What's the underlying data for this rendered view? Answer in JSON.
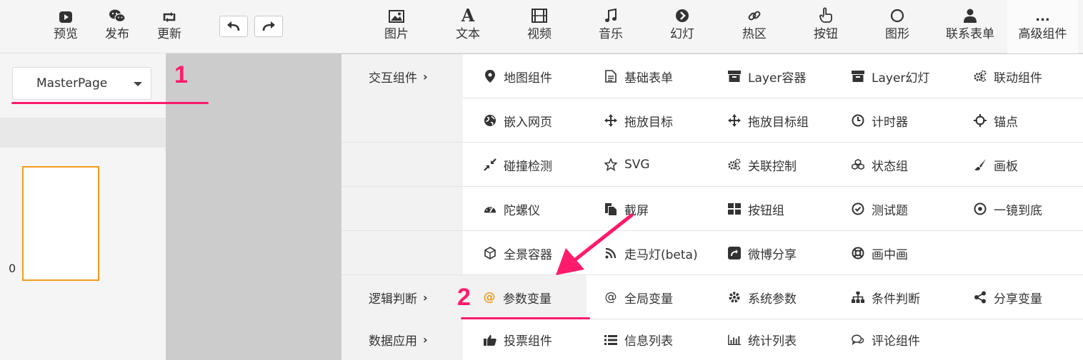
{
  "toolbar": {
    "preview": "预览",
    "publish": "发布",
    "update": "更新",
    "image": "图片",
    "text": "文本",
    "text_glyph": "A",
    "video": "视频",
    "music": "音乐",
    "slide": "幻灯",
    "hotspot": "热区",
    "button": "按钮",
    "shape": "图形",
    "contact_form": "联系表单",
    "advanced": "高级组件",
    "more_glyph": "..."
  },
  "left_panel": {
    "page_select": "MasterPage",
    "page_number": "0"
  },
  "annotations": {
    "one": "1",
    "two": "2"
  },
  "dropdown": {
    "categories": {
      "interaction": "交互组件",
      "logic": "逻辑判断",
      "data": "数据应用",
      "chevron": "›"
    },
    "rows": [
      [
        "地图组件",
        "基础表单",
        "Layer容器",
        "Layer幻灯",
        "联动组件"
      ],
      [
        "嵌入网页",
        "拖放目标",
        "拖放目标组",
        "计时器",
        "锚点"
      ],
      [
        "碰撞检测",
        "SVG",
        "关联控制",
        "状态组",
        "画板"
      ],
      [
        "陀螺仪",
        "截屏",
        "按钮组",
        "测试题",
        "一镜到底"
      ],
      [
        "全景容器",
        "走马灯(beta)",
        "微博分享",
        "画中画"
      ],
      [
        "参数变量",
        "全局变量",
        "系统参数",
        "条件判断",
        "分享变量"
      ],
      [
        "投票组件",
        "信息列表",
        "统计列表",
        "评论组件"
      ]
    ]
  },
  "colors": {
    "accent": "#ff1a6c",
    "thumb_border": "#f29a1b",
    "at_icon": "#f29a1b"
  }
}
